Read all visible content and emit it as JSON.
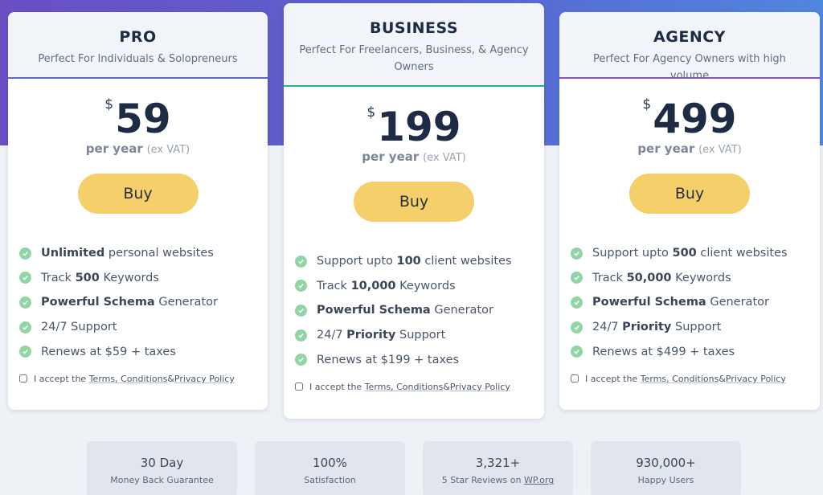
{
  "plans": [
    {
      "name": "PRO",
      "description": "Perfect For Individuals & Solopreneurs",
      "currency": "$",
      "price": "59",
      "period": "per year",
      "vat": "(ex VAT)",
      "buy_label": "Buy",
      "features": [
        {
          "bold": "Unlimited",
          "text": " personal websites"
        },
        {
          "prefix": "Track ",
          "bold": "500",
          "text": " Keywords"
        },
        {
          "bold": "Powerful Schema",
          "text": " Generator"
        },
        {
          "prefix": "24/7 Support"
        },
        {
          "prefix": "Renews at $59 + taxes"
        }
      ]
    },
    {
      "name": "BUSINESS",
      "description": "Perfect For Freelancers, Business, & Agency Owners",
      "currency": "$",
      "price": "199",
      "period": "per year",
      "vat": "(ex VAT)",
      "buy_label": "Buy",
      "features": [
        {
          "prefix": "Support upto ",
          "bold": "100",
          "text": " client websites"
        },
        {
          "prefix": "Track ",
          "bold": "10,000",
          "text": " Keywords"
        },
        {
          "bold": "Powerful Schema",
          "text": " Generator"
        },
        {
          "prefix": "24/7 ",
          "bold": "Priority",
          "text": " Support"
        },
        {
          "prefix": "Renews at $199 + taxes"
        }
      ]
    },
    {
      "name": "AGENCY",
      "description": "Perfect For Agency Owners with high volume",
      "currency": "$",
      "price": "499",
      "period": "per year",
      "vat": "(ex VAT)",
      "buy_label": "Buy",
      "features": [
        {
          "prefix": "Support upto ",
          "bold": "500",
          "text": " client websites"
        },
        {
          "prefix": "Track ",
          "bold": "50,000",
          "text": " Keywords"
        },
        {
          "bold": "Powerful Schema",
          "text": " Generator"
        },
        {
          "prefix": "24/7 ",
          "bold": "Priority",
          "text": " Support"
        },
        {
          "prefix": "Renews at $499 + taxes"
        }
      ]
    }
  ],
  "terms": {
    "prefix": "I accept the ",
    "terms_link": "Terms, Conditions",
    "amp": " & ",
    "privacy_link": "Privacy Policy"
  },
  "stats": [
    {
      "value": "30 Day",
      "label": "Money Back Guarantee"
    },
    {
      "value": "100%",
      "label": "Satisfaction"
    },
    {
      "value": "3,321+",
      "label": "5 Star Reviews on ",
      "link": "WP.org"
    },
    {
      "value": "930,000+",
      "label": "Happy Users"
    }
  ],
  "colors": {
    "accent_buy": "#f5cf6a",
    "check": "#8fd6a4",
    "gradient_start": "#6a4fc4",
    "gradient_end": "#4f86de"
  },
  "icons": {
    "feature": "check-circle-icon"
  }
}
